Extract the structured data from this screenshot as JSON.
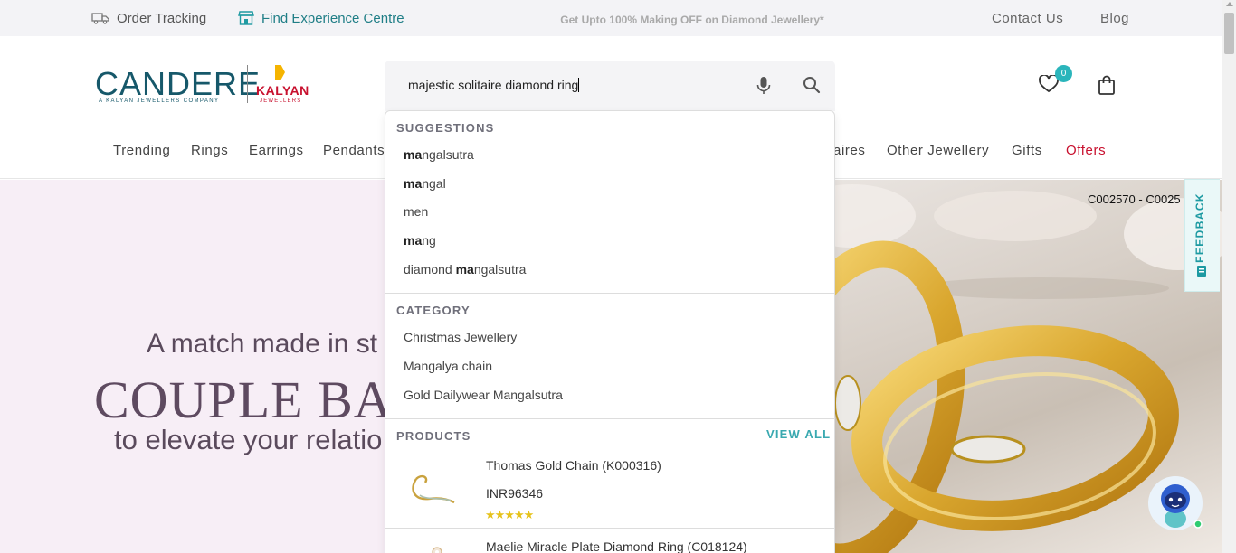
{
  "topbar": {
    "order_tracking": "Order Tracking",
    "experience_centre": "Find Experience Centre",
    "promo": "Get Upto 100% Making OFF on Diamond Jewellery*",
    "contact": "Contact Us",
    "blog": "Blog"
  },
  "logo": {
    "brand": "CANDERE",
    "tagline": "A KALYAN JEWELLERS COMPANY",
    "partner": "KALYAN",
    "partner_sub": "JEWELLERS"
  },
  "search": {
    "value": "majestic solitaire diamond ring"
  },
  "header": {
    "wishlist_count": "0"
  },
  "nav": [
    {
      "label": "Trending"
    },
    {
      "label": "Rings"
    },
    {
      "label": "Earrings"
    },
    {
      "label": "Pendants"
    },
    {
      "label": "aires"
    },
    {
      "label": "Other Jewellery"
    },
    {
      "label": "Gifts"
    },
    {
      "label": "Offers"
    }
  ],
  "dropdown": {
    "suggestions_heading": "SUGGESTIONS",
    "suggestions": [
      {
        "prefix": "",
        "bold": "ma",
        "rest": "ngalsutra"
      },
      {
        "prefix": "",
        "bold": "ma",
        "rest": "ngal"
      },
      {
        "prefix": "men",
        "bold": "",
        "rest": ""
      },
      {
        "prefix": "",
        "bold": "ma",
        "rest": "ng"
      },
      {
        "prefix": "diamond ",
        "bold": "ma",
        "rest": "ngalsutra"
      }
    ],
    "category_heading": "CATEGORY",
    "categories": [
      {
        "label": "Christmas Jewellery"
      },
      {
        "label": "Mangalya chain"
      },
      {
        "label": "Gold Dailywear Mangalsutra"
      }
    ],
    "products_heading": "PRODUCTS",
    "view_all": "VIEW ALL",
    "products": [
      {
        "name": "Thomas Gold Chain (K000316)",
        "price": "INR96346",
        "stars": "★★★★★"
      },
      {
        "name": "Maelie Miracle Plate Diamond Ring (C018124)"
      }
    ]
  },
  "banner": {
    "line1": "A match made in st",
    "line2": "COUPLE BAN",
    "line3": "to elevate your relatio",
    "product_codes": "C002570 - C0025"
  },
  "feedback": {
    "label": "FEEDBACK"
  },
  "colors": {
    "accent": "#2ab5bb",
    "offers": "#c8102e",
    "exp_link": "#1f7e86"
  }
}
